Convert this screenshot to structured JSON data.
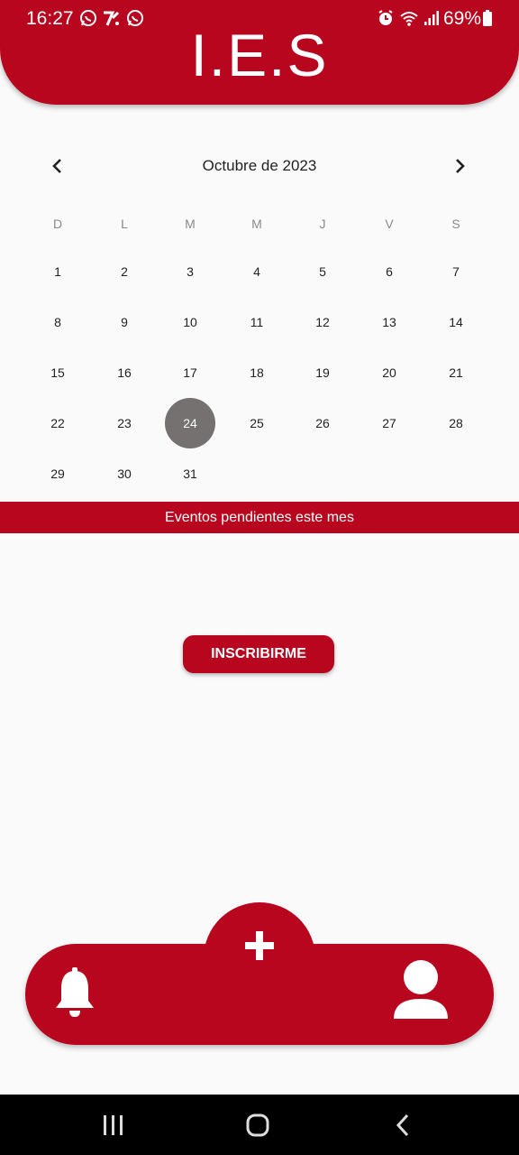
{
  "status_bar": {
    "time": "16:27",
    "battery": "69%",
    "icons": [
      "whatsapp-icon",
      "app-notification-icon",
      "whatsapp-icon",
      "alarm-icon",
      "wifi-icon",
      "signal-icon",
      "battery-icon"
    ]
  },
  "header": {
    "title": "I.E.S"
  },
  "calendar": {
    "month_label": "Octubre de 2023",
    "prev_icon": "chevron-left-icon",
    "next_icon": "chevron-right-icon",
    "weekdays": [
      "D",
      "L",
      "M",
      "M",
      "J",
      "V",
      "S"
    ],
    "days": [
      [
        "1",
        "2",
        "3",
        "4",
        "5",
        "6",
        "7"
      ],
      [
        "8",
        "9",
        "10",
        "11",
        "12",
        "13",
        "14"
      ],
      [
        "15",
        "16",
        "17",
        "18",
        "19",
        "20",
        "21"
      ],
      [
        "22",
        "23",
        "24",
        "25",
        "26",
        "27",
        "28"
      ],
      [
        "29",
        "30",
        "31"
      ]
    ],
    "selected_day": "24"
  },
  "events_banner": "Eventos pendientes este mes",
  "enroll_button": "INSCRIBIRME",
  "bottom_nav": {
    "left_icon": "bell-icon",
    "center_icon": "plus-icon",
    "right_icon": "user-icon"
  },
  "colors": {
    "primary": "#b8061e",
    "selected_day": "#757171",
    "background": "#fafafa"
  }
}
